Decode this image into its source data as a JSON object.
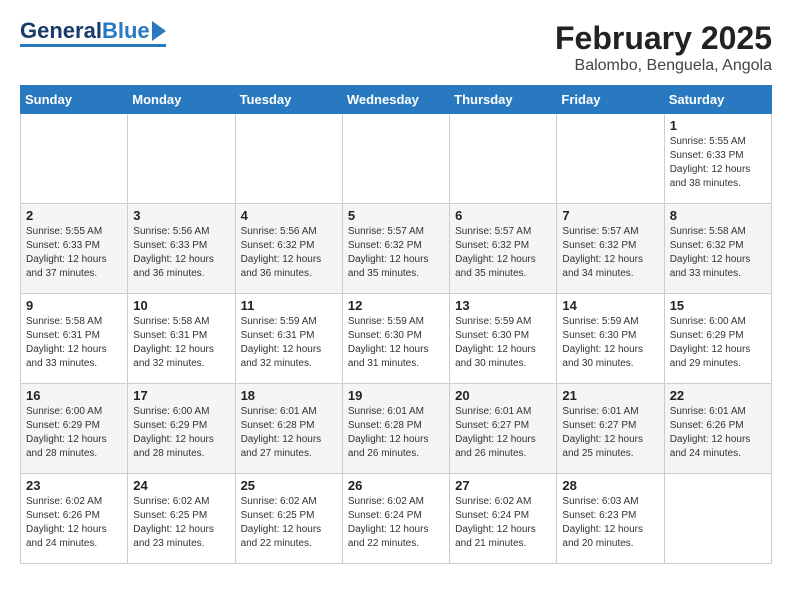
{
  "header": {
    "logo_general": "General",
    "logo_blue": "Blue",
    "title": "February 2025",
    "subtitle": "Balombo, Benguela, Angola"
  },
  "calendar": {
    "weekdays": [
      "Sunday",
      "Monday",
      "Tuesday",
      "Wednesday",
      "Thursday",
      "Friday",
      "Saturday"
    ],
    "weeks": [
      [
        {
          "day": "",
          "info": ""
        },
        {
          "day": "",
          "info": ""
        },
        {
          "day": "",
          "info": ""
        },
        {
          "day": "",
          "info": ""
        },
        {
          "day": "",
          "info": ""
        },
        {
          "day": "",
          "info": ""
        },
        {
          "day": "1",
          "info": "Sunrise: 5:55 AM\nSunset: 6:33 PM\nDaylight: 12 hours\nand 38 minutes."
        }
      ],
      [
        {
          "day": "2",
          "info": "Sunrise: 5:55 AM\nSunset: 6:33 PM\nDaylight: 12 hours\nand 37 minutes."
        },
        {
          "day": "3",
          "info": "Sunrise: 5:56 AM\nSunset: 6:33 PM\nDaylight: 12 hours\nand 36 minutes."
        },
        {
          "day": "4",
          "info": "Sunrise: 5:56 AM\nSunset: 6:32 PM\nDaylight: 12 hours\nand 36 minutes."
        },
        {
          "day": "5",
          "info": "Sunrise: 5:57 AM\nSunset: 6:32 PM\nDaylight: 12 hours\nand 35 minutes."
        },
        {
          "day": "6",
          "info": "Sunrise: 5:57 AM\nSunset: 6:32 PM\nDaylight: 12 hours\nand 35 minutes."
        },
        {
          "day": "7",
          "info": "Sunrise: 5:57 AM\nSunset: 6:32 PM\nDaylight: 12 hours\nand 34 minutes."
        },
        {
          "day": "8",
          "info": "Sunrise: 5:58 AM\nSunset: 6:32 PM\nDaylight: 12 hours\nand 33 minutes."
        }
      ],
      [
        {
          "day": "9",
          "info": "Sunrise: 5:58 AM\nSunset: 6:31 PM\nDaylight: 12 hours\nand 33 minutes."
        },
        {
          "day": "10",
          "info": "Sunrise: 5:58 AM\nSunset: 6:31 PM\nDaylight: 12 hours\nand 32 minutes."
        },
        {
          "day": "11",
          "info": "Sunrise: 5:59 AM\nSunset: 6:31 PM\nDaylight: 12 hours\nand 32 minutes."
        },
        {
          "day": "12",
          "info": "Sunrise: 5:59 AM\nSunset: 6:30 PM\nDaylight: 12 hours\nand 31 minutes."
        },
        {
          "day": "13",
          "info": "Sunrise: 5:59 AM\nSunset: 6:30 PM\nDaylight: 12 hours\nand 30 minutes."
        },
        {
          "day": "14",
          "info": "Sunrise: 5:59 AM\nSunset: 6:30 PM\nDaylight: 12 hours\nand 30 minutes."
        },
        {
          "day": "15",
          "info": "Sunrise: 6:00 AM\nSunset: 6:29 PM\nDaylight: 12 hours\nand 29 minutes."
        }
      ],
      [
        {
          "day": "16",
          "info": "Sunrise: 6:00 AM\nSunset: 6:29 PM\nDaylight: 12 hours\nand 28 minutes."
        },
        {
          "day": "17",
          "info": "Sunrise: 6:00 AM\nSunset: 6:29 PM\nDaylight: 12 hours\nand 28 minutes."
        },
        {
          "day": "18",
          "info": "Sunrise: 6:01 AM\nSunset: 6:28 PM\nDaylight: 12 hours\nand 27 minutes."
        },
        {
          "day": "19",
          "info": "Sunrise: 6:01 AM\nSunset: 6:28 PM\nDaylight: 12 hours\nand 26 minutes."
        },
        {
          "day": "20",
          "info": "Sunrise: 6:01 AM\nSunset: 6:27 PM\nDaylight: 12 hours\nand 26 minutes."
        },
        {
          "day": "21",
          "info": "Sunrise: 6:01 AM\nSunset: 6:27 PM\nDaylight: 12 hours\nand 25 minutes."
        },
        {
          "day": "22",
          "info": "Sunrise: 6:01 AM\nSunset: 6:26 PM\nDaylight: 12 hours\nand 24 minutes."
        }
      ],
      [
        {
          "day": "23",
          "info": "Sunrise: 6:02 AM\nSunset: 6:26 PM\nDaylight: 12 hours\nand 24 minutes."
        },
        {
          "day": "24",
          "info": "Sunrise: 6:02 AM\nSunset: 6:25 PM\nDaylight: 12 hours\nand 23 minutes."
        },
        {
          "day": "25",
          "info": "Sunrise: 6:02 AM\nSunset: 6:25 PM\nDaylight: 12 hours\nand 22 minutes."
        },
        {
          "day": "26",
          "info": "Sunrise: 6:02 AM\nSunset: 6:24 PM\nDaylight: 12 hours\nand 22 minutes."
        },
        {
          "day": "27",
          "info": "Sunrise: 6:02 AM\nSunset: 6:24 PM\nDaylight: 12 hours\nand 21 minutes."
        },
        {
          "day": "28",
          "info": "Sunrise: 6:03 AM\nSunset: 6:23 PM\nDaylight: 12 hours\nand 20 minutes."
        },
        {
          "day": "",
          "info": ""
        }
      ]
    ]
  }
}
